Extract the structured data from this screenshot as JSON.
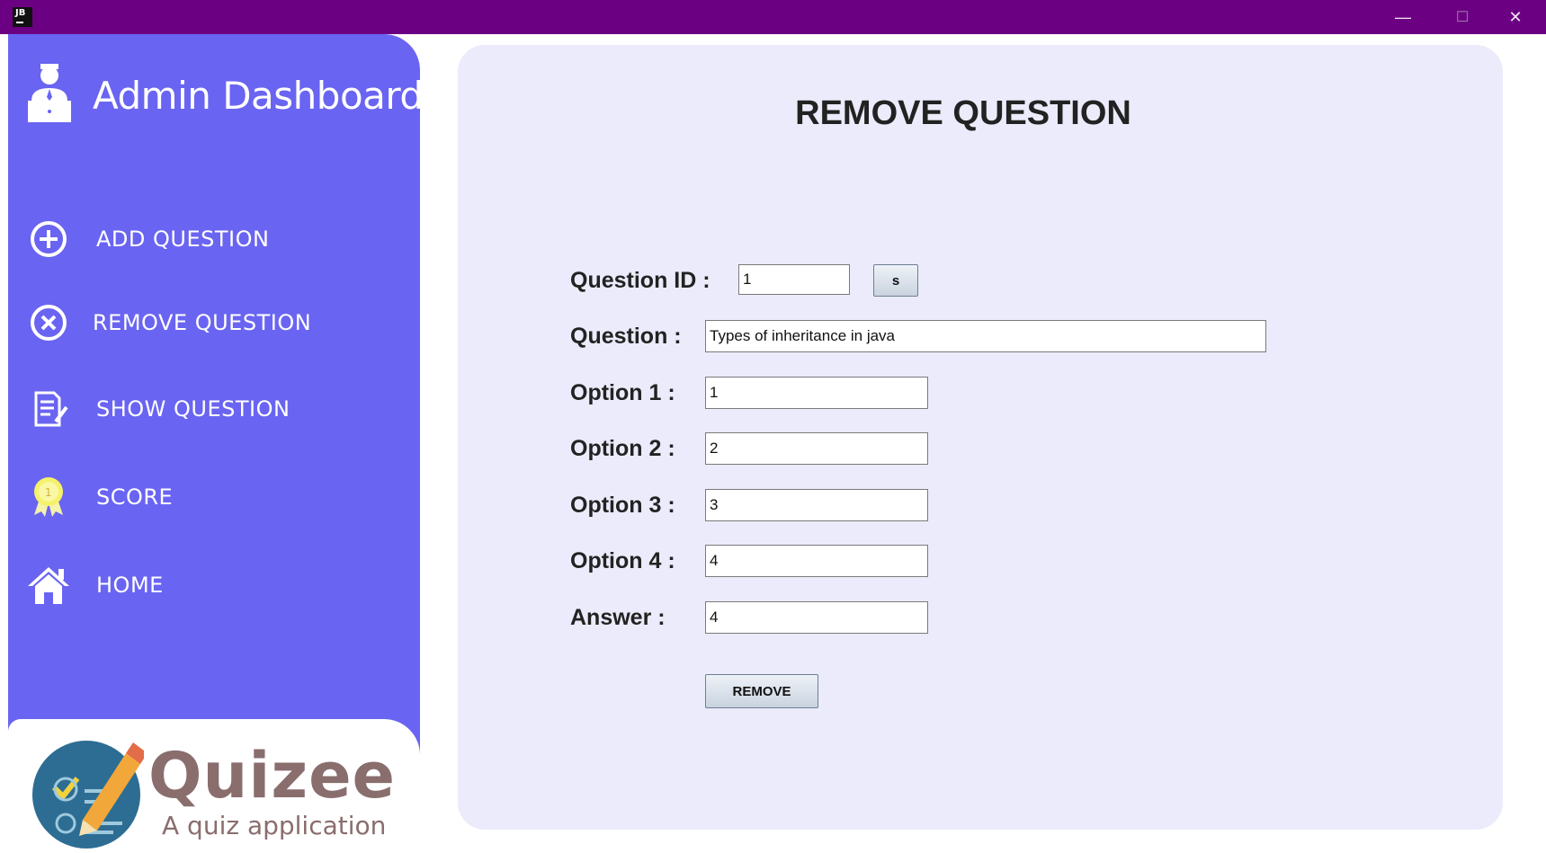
{
  "window": {
    "app_icon_label": "JB",
    "minimize_glyph": "—",
    "maximize_glyph": "☐",
    "close_glyph": "✕"
  },
  "sidebar": {
    "title": "Admin Dashboard",
    "items": [
      {
        "label": "ADD QUESTION",
        "icon": "add-circle-icon"
      },
      {
        "label": "REMOVE QUESTION",
        "icon": "remove-circle-icon"
      },
      {
        "label": "SHOW QUESTION",
        "icon": "document-edit-icon"
      },
      {
        "label": "SCORE",
        "icon": "medal-icon"
      },
      {
        "label": "HOME",
        "icon": "home-icon"
      }
    ]
  },
  "logo": {
    "name": "Quizee",
    "tagline": "A quiz application"
  },
  "form": {
    "title": "REMOVE QUESTION",
    "labels": {
      "question_id": "Question ID :",
      "question": "Question :",
      "option1": "Option 1 :",
      "option2": "Option 2 :",
      "option3": "Option 3 :",
      "option4": "Option 4 :",
      "answer": "Answer :"
    },
    "values": {
      "question_id": "1",
      "question": "Types of inheritance in java",
      "option1": "1",
      "option2": "2",
      "option3": "3",
      "option4": "4",
      "answer": "4"
    },
    "search_button": "s",
    "remove_button": "REMOVE"
  },
  "colors": {
    "titlebar": "#6c0083",
    "sidebar": "#6a64f2",
    "panel": "#ebebfb"
  }
}
